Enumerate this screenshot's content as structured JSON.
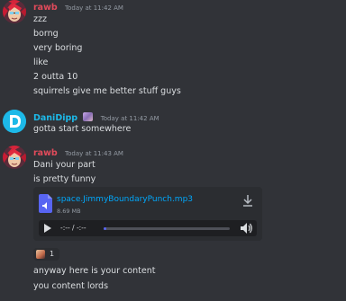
{
  "colors": {
    "rawb": "#e24b5b",
    "danidipp": "#1db9e8",
    "accent": "#5865f2",
    "link": "#00a8fc"
  },
  "messages": [
    {
      "username": "rawb",
      "timestamp": "Today at 11:42 AM",
      "lines": [
        "zzz",
        "borng",
        "very boring",
        "like",
        "2 outta 10",
        "squirrels give me better stuff guys"
      ]
    },
    {
      "username": "DaniDipp",
      "timestamp": "Today at 11:42 AM",
      "lines": [
        "gotta start somewhere"
      ]
    },
    {
      "username": "rawb",
      "timestamp": "Today at 11:43 AM",
      "lines": [
        "Dani your part",
        "is pretty funny"
      ],
      "attachment": {
        "icon": "audio-file-icon",
        "filename": "space.JimmyBoundaryPunch.mp3",
        "size": "8.69 MB",
        "time": "-:-- / -:--",
        "progress": 0
      },
      "reaction": {
        "emoji": "avatar-emoji",
        "count": "1"
      },
      "after_lines": [
        "anyway here is your content",
        "you content lords"
      ]
    }
  ]
}
